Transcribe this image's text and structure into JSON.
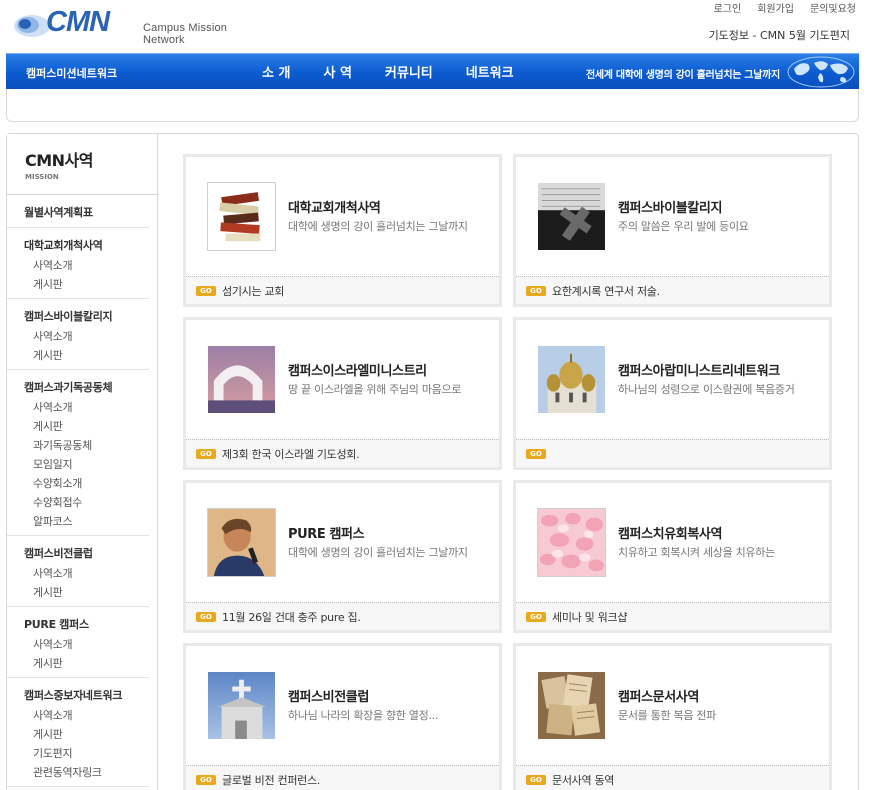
{
  "header": {
    "logo_text": "CMN",
    "logo_sub": "Campus Mission Network",
    "top_links": [
      "로그인",
      "회원가입",
      "문의및요청"
    ],
    "prayer_info": "기도정보 - CMN 5월 기도편지"
  },
  "nav": {
    "brand": "캠퍼스미션네트워크",
    "menu": [
      "소 개",
      "사 역",
      "커뮤니티",
      "네트워크"
    ],
    "slogan": "전세계 대학에 생명의 강이 흘러넘치는 그날까지"
  },
  "sidebar": {
    "title": "CMN사역",
    "subtitle": "MISSION",
    "groups": [
      {
        "title": "월별사역계획표",
        "items": []
      },
      {
        "title": "대학교회개척사역",
        "items": [
          "사역소개",
          "게시판"
        ]
      },
      {
        "title": "캠퍼스바이블칼리지",
        "items": [
          "사역소개",
          "게시판"
        ]
      },
      {
        "title": "캠퍼스과기독공동체",
        "items": [
          "사역소개",
          "게시판",
          "과기독공동체",
          "모임일지",
          "수양회소개",
          "수양회접수",
          "알파코스"
        ]
      },
      {
        "title": "캠퍼스비전클럽",
        "items": [
          "사역소개",
          "게시판"
        ]
      },
      {
        "title": "PURE 캠퍼스",
        "items": [
          "사역소개",
          "게시판"
        ]
      },
      {
        "title": "캠퍼스중보자네트워크",
        "items": [
          "사역소개",
          "게시판",
          "기도편지",
          "관련동역자링크"
        ]
      }
    ]
  },
  "cards": [
    {
      "title": "대학교회개척사역",
      "desc": "대학에 생명의 강이 흘러넘치는 그날까지",
      "go": "GO",
      "foot": "섬기시는 교회",
      "icon": "books-icon"
    },
    {
      "title": "캠퍼스바이블칼리지",
      "desc": "주의 말씀은 우리 발에 등이요",
      "go": "GO",
      "foot": "요한계시록 연구서 저술.",
      "icon": "bible-cross-icon"
    },
    {
      "title": "캠퍼스이스라엘미니스트리",
      "desc": "땅 끝 이스라엘을 위해 주님의 마음으로",
      "go": "GO",
      "foot": "제3회 한국 이스라엘 기도성회.",
      "icon": "arch-icon"
    },
    {
      "title": "캠퍼스아랍미니스트리네트워크",
      "desc": "하나님의 성령으로 이스람권에 복음증거",
      "go": "GO",
      "foot": "",
      "icon": "domes-icon"
    },
    {
      "title": "PURE 캠퍼스",
      "desc": "대학에 생명의 강이 흘러넘치는 그날까지",
      "go": "GO",
      "foot": "11월 26일 건대 충주 pure 집.",
      "icon": "speaker-icon"
    },
    {
      "title": "캠퍼스치유회복사역",
      "desc": "치유하고 회복시켜 세상을 치유하는",
      "go": "GO",
      "foot": "세미나 및 워크샵",
      "icon": "petals-icon"
    },
    {
      "title": "캠퍼스비전클럽",
      "desc": "하나님 나라의 확장을 향한 열정...",
      "go": "GO",
      "foot": "글로벌 비전 컨퍼런스.",
      "icon": "church-cross-icon"
    },
    {
      "title": "캠퍼스문서사역",
      "desc": "문서를 통한 복음 전파",
      "go": "GO",
      "foot": "문서사역 동역",
      "icon": "papers-icon"
    }
  ]
}
